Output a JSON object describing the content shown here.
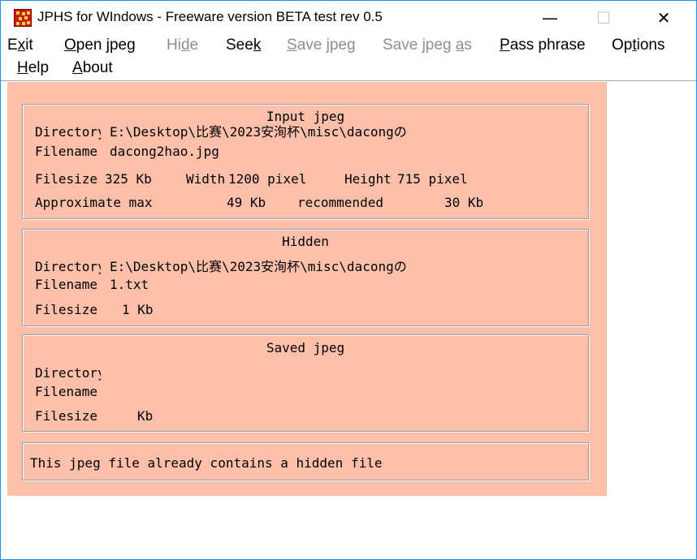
{
  "window": {
    "title": "JPHS for WIndows - Freeware version BETA test rev 0.5",
    "minimize_glyph": "—",
    "maximize_glyph": "☐",
    "close_glyph": "✕",
    "icon": "jphs-app-icon"
  },
  "menu": {
    "exit": {
      "pre": "E",
      "ul": "x",
      "post": "it"
    },
    "open_jpeg": {
      "pre": "",
      "ul": "O",
      "post": "pen jpeg"
    },
    "hide": {
      "pre": "Hi",
      "ul": "d",
      "post": "e"
    },
    "seek": {
      "pre": "See",
      "ul": "k",
      "post": ""
    },
    "save_jpeg": {
      "pre": "",
      "ul": "S",
      "post": "ave jpeg"
    },
    "save_jpeg_as": {
      "pre": "Save jpeg ",
      "ul": "a",
      "post": "s"
    },
    "pass_phrase": {
      "pre": "",
      "ul": "P",
      "post": "ass phrase"
    },
    "options": {
      "pre": "Op",
      "ul": "t",
      "post": "ions"
    },
    "help": {
      "pre": "",
      "ul": "H",
      "post": "elp"
    },
    "about": {
      "pre": "",
      "ul": "A",
      "post": "bout"
    }
  },
  "input_jpeg": {
    "title": "Input jpeg",
    "directory_label": "Directory",
    "directory_value": "E:\\Desktop\\比赛\\2023安洵杯\\misc\\dacongの",
    "filename_label": "Filename",
    "filename_value": "dacong2hao.jpg",
    "filesize_label": "Filesize",
    "filesize_value": "325 Kb",
    "width_label": "Width",
    "width_value": "1200 pixel",
    "height_label": "Height",
    "height_value": "715 pixel",
    "approx_label": "Approximate max",
    "approx_value": "49 Kb",
    "recommended_label": "recommended",
    "recommended_value": "30 Kb"
  },
  "hidden": {
    "title": "Hidden",
    "directory_label": "Directory",
    "directory_value": "E:\\Desktop\\比赛\\2023安洵杯\\misc\\dacongの",
    "filename_label": "Filename",
    "filename_value": "1.txt",
    "filesize_label": "Filesize",
    "filesize_value": "1 Kb"
  },
  "saved_jpeg": {
    "title": "Saved jpeg",
    "directory_label": "Directory",
    "directory_value": "",
    "filename_label": "Filename",
    "filename_value": "",
    "filesize_label": "Filesize",
    "filesize_value": "Kb"
  },
  "status": {
    "message": "This jpeg file already contains a hidden file"
  },
  "colors": {
    "client_bg": "#fec0ab",
    "window_border": "#1e90e8",
    "disabled_menu": "#8e8e8e"
  }
}
